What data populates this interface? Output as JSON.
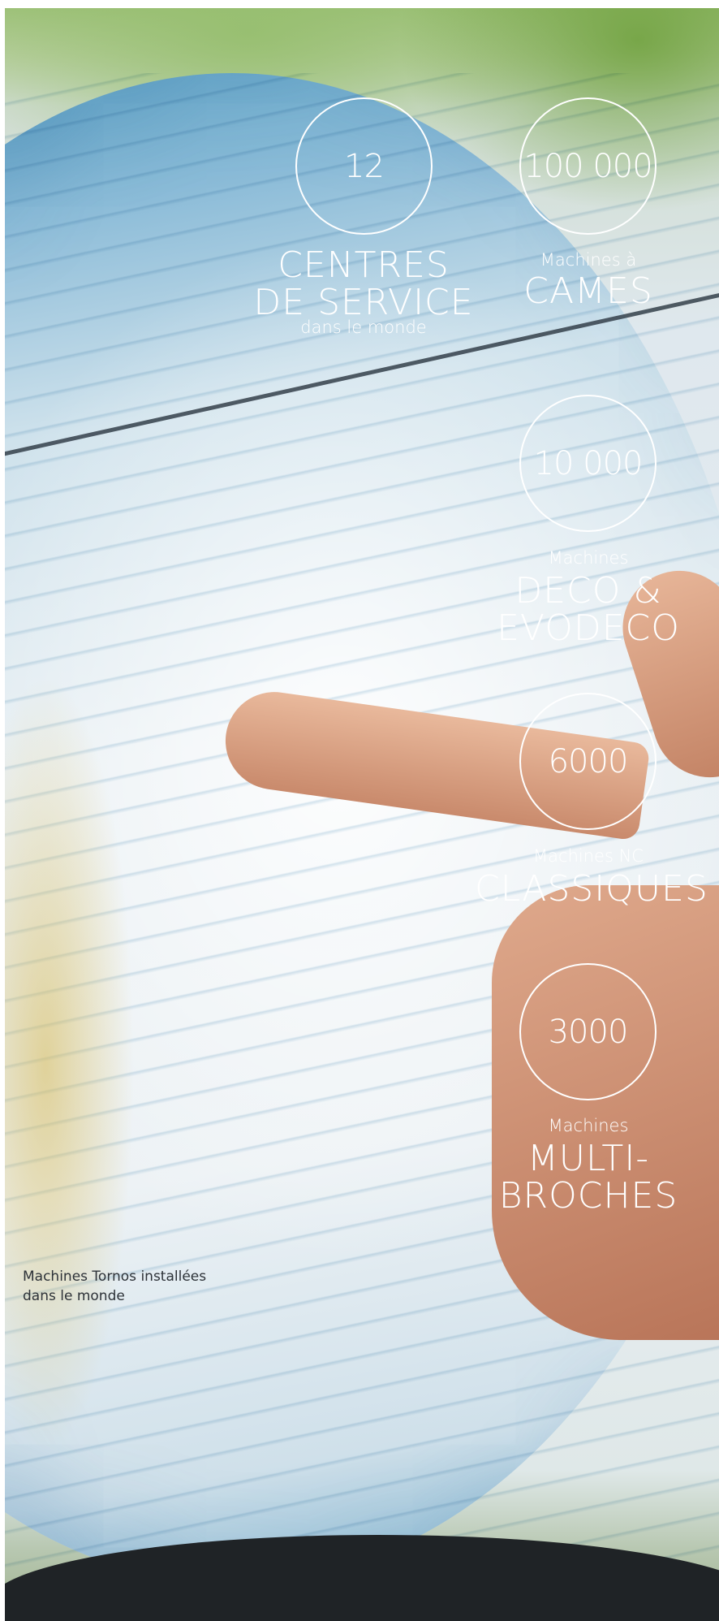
{
  "stats": [
    {
      "number": "12",
      "top": "",
      "title_1": "CENTRES",
      "title_2": "DE SERVICE",
      "bottom": "dans le monde"
    },
    {
      "number": "100 000",
      "top": "Machines à",
      "title_1": "CAMES",
      "title_2": "",
      "bottom": ""
    },
    {
      "number": "10 000",
      "top": "Machines",
      "title_1": "DECO &",
      "title_2": "EVODECO",
      "bottom": ""
    },
    {
      "number": "6000",
      "top": "Machines NC",
      "title_1": "CLASSIQUES",
      "title_2": "",
      "bottom": ""
    },
    {
      "number": "3000",
      "top": "Machines",
      "title_1": "MULTI-",
      "title_2": "BROCHES",
      "bottom": ""
    }
  ],
  "caption": {
    "line_1": "Machines Tornos installées",
    "line_2": "dans le monde"
  },
  "colors": {
    "text_light": "#ffffff",
    "caption": "#2d3238"
  }
}
